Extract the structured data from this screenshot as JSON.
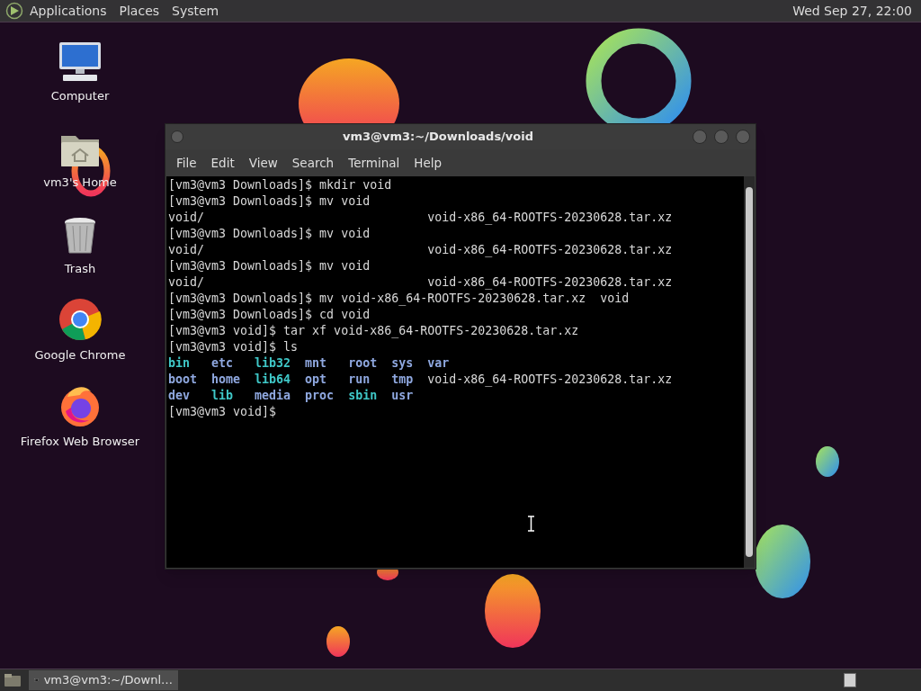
{
  "top_panel": {
    "menus": [
      "Applications",
      "Places",
      "System"
    ],
    "clock": "Wed Sep 27, 22:00"
  },
  "desktop_icons": [
    {
      "label": "Computer",
      "kind": "computer"
    },
    {
      "label": "vm3's Home",
      "kind": "home"
    },
    {
      "label": "Trash",
      "kind": "trash"
    },
    {
      "label": "Google Chrome",
      "kind": "chrome"
    },
    {
      "label": "Firefox Web Browser",
      "kind": "firefox"
    }
  ],
  "window": {
    "title": "vm3@vm3:~/Downloads/void",
    "menu": [
      "File",
      "Edit",
      "View",
      "Search",
      "Terminal",
      "Help"
    ],
    "terminal": {
      "lines": [
        {
          "kind": "text",
          "text": "[vm3@vm3 Downloads]$ mkdir void"
        },
        {
          "kind": "text",
          "text": "[vm3@vm3 Downloads]$ mv void"
        },
        {
          "kind": "columns",
          "columns": [
            "void/",
            "void-x86_64-ROOTFS-20230628.tar.xz"
          ]
        },
        {
          "kind": "text",
          "text": "[vm3@vm3 Downloads]$ mv void"
        },
        {
          "kind": "columns",
          "columns": [
            "void/",
            "void-x86_64-ROOTFS-20230628.tar.xz"
          ]
        },
        {
          "kind": "text",
          "text": "[vm3@vm3 Downloads]$ mv void"
        },
        {
          "kind": "columns",
          "columns": [
            "void/",
            "void-x86_64-ROOTFS-20230628.tar.xz"
          ]
        },
        {
          "kind": "text",
          "text": "[vm3@vm3 Downloads]$ mv void-x86_64-ROOTFS-20230628.tar.xz  void"
        },
        {
          "kind": "text",
          "text": "[vm3@vm3 Downloads]$ cd void"
        },
        {
          "kind": "text",
          "text": "[vm3@vm3 void]$ tar xf void-x86_64-ROOTFS-20230628.tar.xz"
        },
        {
          "kind": "text",
          "text": "[vm3@vm3 void]$ ls"
        },
        {
          "kind": "ls",
          "entries": [
            {
              "name": "bin",
              "kind": "link"
            },
            {
              "name": "etc",
              "kind": "dir"
            },
            {
              "name": "lib32",
              "kind": "link"
            },
            {
              "name": "mnt",
              "kind": "dir"
            },
            {
              "name": "root",
              "kind": "dir"
            },
            {
              "name": "sys",
              "kind": "dir"
            },
            {
              "name": "var",
              "kind": "dir"
            }
          ]
        },
        {
          "kind": "ls",
          "entries": [
            {
              "name": "boot",
              "kind": "dir"
            },
            {
              "name": "home",
              "kind": "dir"
            },
            {
              "name": "lib64",
              "kind": "link"
            },
            {
              "name": "opt",
              "kind": "dir"
            },
            {
              "name": "run",
              "kind": "dir"
            },
            {
              "name": "tmp",
              "kind": "dir"
            },
            {
              "name": "void-x86_64-ROOTFS-20230628.tar.xz",
              "kind": "file"
            }
          ]
        },
        {
          "kind": "ls",
          "entries": [
            {
              "name": "dev",
              "kind": "dir"
            },
            {
              "name": "lib",
              "kind": "link"
            },
            {
              "name": "media",
              "kind": "dir"
            },
            {
              "name": "proc",
              "kind": "dir"
            },
            {
              "name": "sbin",
              "kind": "link"
            },
            {
              "name": "usr",
              "kind": "dir"
            }
          ]
        },
        {
          "kind": "text",
          "text": "[vm3@vm3 void]$"
        }
      ]
    }
  },
  "taskbar": {
    "tasks": [
      {
        "label": "vm3@vm3:~/Downl…",
        "selected": true
      }
    ]
  }
}
